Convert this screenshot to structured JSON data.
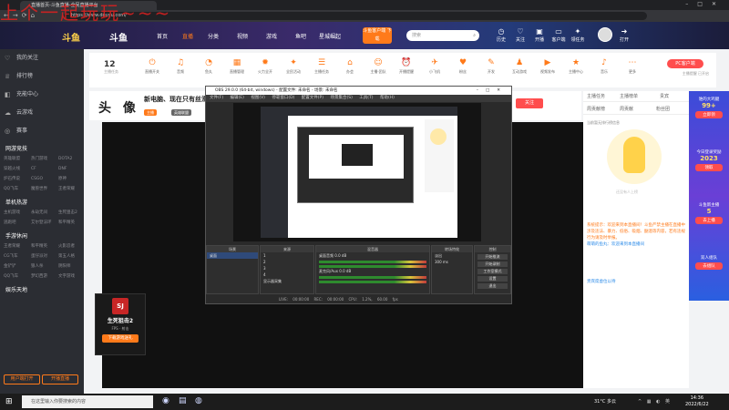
{
  "browser": {
    "tab_title": "直播首页-斗鱼直播-全民直播平台",
    "url": "https://www.douyu.com/",
    "overlay_text": "上个一起玩玩~~~"
  },
  "header": {
    "logo": "斗鱼",
    "logo2": "斗鱼",
    "nav": [
      "首页",
      "直播",
      "分类",
      "视频",
      "游戏",
      "鱼吧",
      "星城崛起"
    ],
    "download": "斗鱼客户端 下载",
    "search_placeholder": "搜索",
    "icons": [
      "历史",
      "关注",
      "开播",
      "客户端",
      "领任务",
      "打开"
    ]
  },
  "sidebar": {
    "main": [
      {
        "icon": "heart-icon",
        "label": "我的关注"
      },
      {
        "icon": "trophy-icon",
        "label": "排行榜"
      },
      {
        "icon": "bag-icon",
        "label": "充能中心"
      },
      {
        "icon": "cloud-icon",
        "label": "云游戏"
      },
      {
        "icon": "ticket-icon",
        "label": "赛事"
      }
    ],
    "sections": [
      {
        "title": "网游竞技",
        "items": [
          "英雄联盟",
          "热门游戏",
          "DOTA2",
          "穿越火线",
          "CF",
          "DNF",
          "炉石传说",
          "CSGO",
          "原神",
          "QQ飞车",
          "魔兽世界",
          "王者荣耀"
        ]
      },
      {
        "title": "单机热游",
        "items": [
          "主机游戏",
          "永劫无间",
          "生死狙击2",
          "逃跑吧",
          "艾尔登法环",
          "和平精英"
        ]
      },
      {
        "title": "手游休闲",
        "items": [
          "王者荣耀",
          "和平精英",
          "火影忍者",
          "CG飞车",
          "蛋仔派对",
          "第五人格",
          "金铲铲",
          "狼人杀",
          "阴阳师",
          "QQ飞车",
          "梦幻西游",
          "文字游戏"
        ]
      },
      {
        "title": "娱乐天地",
        "items": []
      }
    ],
    "buttons": [
      "用户端打开",
      "开播直播"
    ]
  },
  "toolbar": {
    "day": "12",
    "day_label": "主播任务",
    "items": [
      "直播开关",
      "音频",
      "鱼丸",
      "直播管理",
      "火力全开",
      "全民活动",
      "主播任务",
      "办会",
      "主播·团队",
      "开播提醒",
      "小飞机",
      "粉丝",
      "开发",
      "互动游戏",
      "视频发布",
      "主播中心",
      "音乐",
      "更多"
    ],
    "pc_button": "PC客户端",
    "pc_sub": "主播提醒 已开启"
  },
  "room": {
    "avatar_text": "头 像",
    "title": "新电脑、现在只有丝滑",
    "tags": [
      "主播",
      "英雄联盟",
      "新手主播"
    ],
    "follow": "关注"
  },
  "promo": {
    "badge": "SJ",
    "name": "生死狙击2",
    "tags": "FPS · 射击",
    "button": "下载游戏送礼"
  },
  "right_panel": {
    "tabs": [
      "主播任务",
      "主播榜单",
      "贵宾"
    ],
    "tabs2": [
      "周贡献榜",
      "周贡献",
      "粉丝团"
    ],
    "notice": "当前暂无排行榜信息",
    "mascot_caption": "还没有人上榜",
    "chat": [
      {
        "type": "sys",
        "text": "系统提示：欢迎来到本直播间！斗鱼严禁主播在直播中涉及违法、暴力、低俗、吸烟、酗酒等内容，若有违规行为请及时举报。"
      },
      {
        "type": "name",
        "text": "萌萌的鱼丸：欢迎来到本直播间"
      }
    ],
    "gift_row": "贵宾席虚位以待"
  },
  "promo_strip": [
    {
      "title": "谁的大鸡腿",
      "num": "99+",
      "btn": "立即领"
    },
    {
      "title": "今日登录奖励",
      "num": "2023",
      "btn": "领取"
    },
    {
      "title": "斗鱼新主播",
      "num": "5",
      "btn": "去上播"
    },
    {
      "title": "双人组队",
      "num": "",
      "btn": "去组队"
    }
  ],
  "obs": {
    "title": "OBS 29.0.0 (64-bit, windows) - 配置文件: 未命名 - 场景: 未命名",
    "menu": [
      "文件(F)",
      "编辑(E)",
      "视图(V)",
      "停靠窗口(D)",
      "配置文件(P)",
      "场景集合(S)",
      "工具(T)",
      "帮助(H)"
    ],
    "docks": {
      "scenes_title": "场景",
      "scenes": [
        "桌面"
      ],
      "sources_title": "来源",
      "sources": [
        "1",
        "2",
        "3",
        "4",
        "显示器采集"
      ],
      "mixer_title": "混音器",
      "mixer": [
        {
          "label": "桌面音频",
          "db": "0.0 dB"
        },
        {
          "label": "麦克风/Aux",
          "db": "0.0 dB"
        }
      ],
      "transitions_title": "转场特效",
      "transition": "淡出",
      "duration": "300 ms",
      "controls_title": "控制",
      "controls": [
        "开始推流",
        "开始录制",
        "工作室模式",
        "设置",
        "退出"
      ]
    },
    "status": "LIVE: 00:00:00   REC: 00:00:00   CPU: 1.2%, 60.00 fps"
  },
  "taskbar": {
    "search_placeholder": "在这里输入你要搜索的内容",
    "weather": "31°C 多云",
    "time": "14:36",
    "date": "2022/6/22"
  }
}
